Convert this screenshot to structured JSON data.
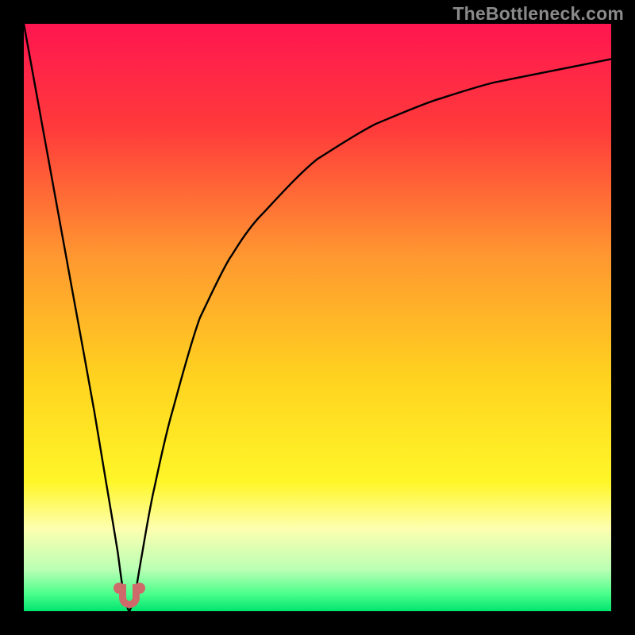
{
  "watermark": "TheBottleneck.com",
  "chart_data": {
    "type": "line",
    "title": "",
    "xlabel": "",
    "ylabel": "",
    "xlim": [
      0,
      100
    ],
    "ylim": [
      0,
      100
    ],
    "grid": false,
    "legend": false,
    "series": [
      {
        "name": "curve",
        "x": [
          0,
          4,
          8,
          12,
          14,
          16,
          17,
          18,
          19,
          20,
          22,
          25,
          30,
          35,
          40,
          50,
          60,
          70,
          80,
          90,
          100
        ],
        "y": [
          100,
          78,
          56,
          34,
          22,
          10,
          3,
          0,
          3,
          9,
          20,
          33,
          50,
          60,
          67,
          77,
          83,
          87,
          90,
          92,
          94
        ]
      }
    ],
    "optimal_zone": {
      "x": 18,
      "y": 0
    },
    "gradient_stops": [
      {
        "pos": 0.0,
        "color": "#ff1650"
      },
      {
        "pos": 0.18,
        "color": "#ff3b3b"
      },
      {
        "pos": 0.4,
        "color": "#ff9930"
      },
      {
        "pos": 0.6,
        "color": "#ffd21f"
      },
      {
        "pos": 0.78,
        "color": "#fff629"
      },
      {
        "pos": 0.86,
        "color": "#fdffb0"
      },
      {
        "pos": 0.93,
        "color": "#b8ffb4"
      },
      {
        "pos": 0.97,
        "color": "#4dff8c"
      },
      {
        "pos": 1.0,
        "color": "#00e56f"
      }
    ]
  }
}
